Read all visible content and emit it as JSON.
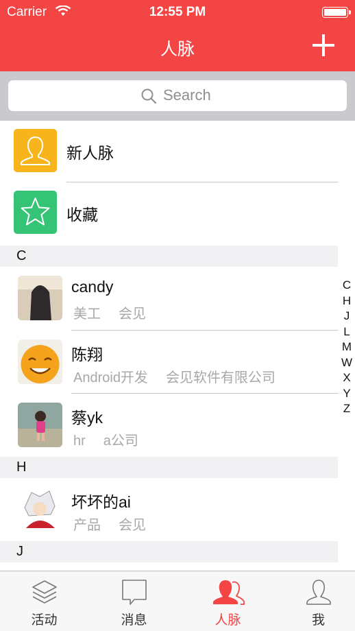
{
  "status_bar": {
    "carrier": "Carrier",
    "time": "12:55 PM"
  },
  "nav": {
    "title": "人脉",
    "add_icon": "plus-icon"
  },
  "search": {
    "placeholder": "Search"
  },
  "fixed_rows": [
    {
      "label": "新人脉",
      "icon": "person-outline-icon",
      "color": "#f7b41b"
    },
    {
      "label": "收藏",
      "icon": "star-outline-icon",
      "color": "#35c476"
    }
  ],
  "sections": [
    {
      "letter": "C",
      "contacts": [
        {
          "name": "candy",
          "title": "美工",
          "company": "会见"
        },
        {
          "name": "陈翔",
          "title": "Android开发",
          "company": "会见软件有限公司"
        },
        {
          "name": "蔡yk",
          "title": "hr",
          "company": "a公司"
        }
      ]
    },
    {
      "letter": "H",
      "contacts": [
        {
          "name": "坏坏的ai",
          "title": "产品",
          "company": "会见"
        }
      ]
    },
    {
      "letter": "J",
      "contacts": []
    }
  ],
  "index_letters": [
    "C",
    "H",
    "J",
    "L",
    "M",
    "W",
    "X",
    "Y",
    "Z"
  ],
  "tabs": [
    {
      "label": "活动",
      "icon": "layers-icon",
      "active": false
    },
    {
      "label": "消息",
      "icon": "chat-bubble-icon",
      "active": false
    },
    {
      "label": "人脉",
      "icon": "contacts-icon",
      "active": true
    },
    {
      "label": "我",
      "icon": "user-icon",
      "active": false
    }
  ],
  "colors": {
    "accent": "#f44545",
    "section_bg": "#f1f1f3",
    "secondary_text": "#a8a8a8"
  }
}
